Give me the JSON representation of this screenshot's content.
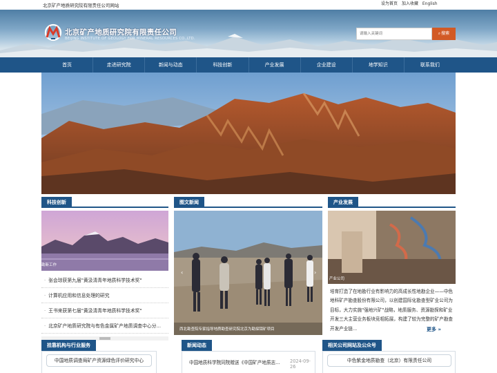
{
  "topbar": {
    "site_name": "北京矿产地质研究院有限责任公司网站",
    "links": [
      "设为首页",
      "加入收藏",
      "English"
    ]
  },
  "header": {
    "company_cn": "北京矿产地质研究院有限责任公司",
    "company_en": "BEIJING INSTITUTE OF GEOLOGY FOR MINERAL RESOURCES CO.,LTD.",
    "search_placeholder": "请输入关键词",
    "search_button": "搜索"
  },
  "nav": {
    "items": [
      "首页",
      "走进研究院",
      "新闻与动态",
      "科技创新",
      "产业发展",
      "企业建设",
      "地学知识",
      "联系我们"
    ]
  },
  "sections": {
    "tech": {
      "title": "科技创新",
      "image_caption": "勘新工作",
      "items": [
        "张会琼获第九届\"黄汲清青年地质科学技术奖\"",
        "计算机应用和信息处理的研究",
        "王书来获第七届\"黄汲清青年地质科学技术奖\"",
        "北京矿产地质研究院与有色金属矿产地质调查中心分..."
      ]
    },
    "photo_news": {
      "title": "图文新闻",
      "caption": "西北勘查院专家指导地质勘查研究院北京为勘探钼矿项目"
    },
    "industry": {
      "title": "产业发展",
      "image_caption": "产业公司",
      "text": "培育打造了在地勘行业有影响力的高成长性地勘企业——中色地科矿产勘查股份有限公司，以创建国际化勘查型矿业公司为目标，大力实施\"强地兴矿\"战略，地质服务、资源勘探和矿业开发三大主营业务板块竞相拓展，构建了较为完整的矿产勘查开发产业链...",
      "more": "更多"
    }
  },
  "bottom": {
    "institutions": {
      "title": "挂靠机构与行业服务",
      "items": [
        "中国地质调查局矿产资源绿色评价研究中心"
      ]
    },
    "news": {
      "title": "新闻动态",
      "items": [
        {
          "text": "中国地质科学院同院赠送《中国矿产地质志...",
          "date": "2024-09-26"
        }
      ]
    },
    "related": {
      "title": "相关公司网站及公众号",
      "items": [
        "中色紫金地质勘查（北京）有限责任公司"
      ]
    }
  }
}
